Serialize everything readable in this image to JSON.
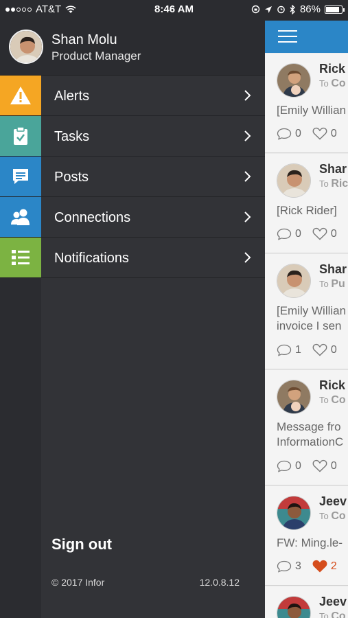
{
  "status_bar": {
    "carrier": "AT&T",
    "time": "8:46 AM",
    "battery": "86%",
    "battery_level": 0.86,
    "signal_bars": 2
  },
  "profile": {
    "name": "Shan Molu",
    "role": "Product Manager"
  },
  "menu": [
    {
      "label": "Alerts",
      "icon": "warning-icon",
      "color": "#f5a623"
    },
    {
      "label": "Tasks",
      "icon": "clipboard-check-icon",
      "color": "#4aa59a"
    },
    {
      "label": "Posts",
      "icon": "speech-bubble-icon",
      "color": "#2b86c7"
    },
    {
      "label": "Connections",
      "icon": "people-icon",
      "color": "#2b86c7"
    },
    {
      "label": "Notifications",
      "icon": "list-icon",
      "color": "#7cb342"
    }
  ],
  "footer": {
    "sign_out": "Sign out",
    "copyright": "© 2017 Infor",
    "version": "12.0.8.12"
  },
  "feed": {
    "accent": "#2b86c7",
    "to_prefix": "To",
    "cards": [
      {
        "author": "Rick",
        "to": "Co",
        "body": [
          "[Emily Willian"
        ],
        "comments": "0",
        "likes": "0",
        "liked": false
      },
      {
        "author": "Shar",
        "to": "Ric",
        "body": [
          "[Rick Rider]"
        ],
        "comments": "0",
        "likes": "0",
        "liked": false
      },
      {
        "author": "Shar",
        "to": "Pu",
        "body": [
          "[Emily Willian",
          "invoice I sen"
        ],
        "comments": "1",
        "likes": "0",
        "liked": false
      },
      {
        "author": "Rick",
        "to": "Co",
        "body": [
          "Message fro",
          "InformationC"
        ],
        "comments": "0",
        "likes": "0",
        "liked": false
      },
      {
        "author": "Jeev",
        "to": "Co",
        "body": [
          "FW: Ming.le-"
        ],
        "comments": "3",
        "likes": "2",
        "liked": true
      },
      {
        "author": "Jeev",
        "to": "Co",
        "body": [],
        "comments": "",
        "likes": "",
        "liked": false
      }
    ]
  }
}
